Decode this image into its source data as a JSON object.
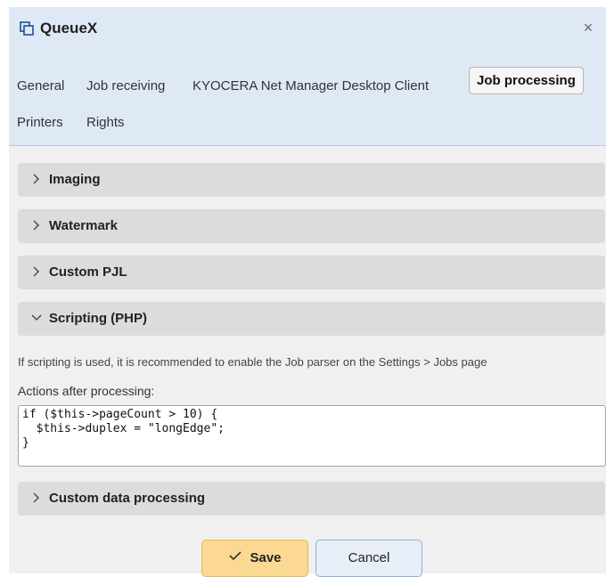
{
  "dialog": {
    "title": "QueueX",
    "close_label": "×",
    "tabs": [
      {
        "label": "General"
      },
      {
        "label": "Job receiving"
      },
      {
        "label": "KYOCERA Net Manager Desktop Client"
      },
      {
        "label": "Job processing",
        "active": true
      },
      {
        "label": "Printers"
      },
      {
        "label": "Rights"
      }
    ]
  },
  "sections": [
    {
      "label": "Imaging",
      "expanded": false
    },
    {
      "label": "Watermark",
      "expanded": false
    },
    {
      "label": "Custom PJL",
      "expanded": false
    },
    {
      "label": "Scripting (PHP)",
      "expanded": true
    },
    {
      "label": "Custom data processing",
      "expanded": false
    }
  ],
  "scripting": {
    "info": "If scripting is used, it is recommended to enable the Job parser on the Settings > Jobs page",
    "actions_label": "Actions after processing:",
    "code": "if ($this->pageCount > 10) {\n  $this->duplex = \"longEdge\";\n}"
  },
  "footer": {
    "save_label": "Save",
    "cancel_label": "Cancel"
  },
  "colors": {
    "header_bg": "#dfe9f6",
    "section_bg": "#dcdcdc",
    "save_bg": "#fbd992",
    "cancel_bg": "#e8eef7"
  },
  "icons": {
    "title": "copy-windows-icon",
    "collapsed": "chevron-right-icon",
    "expanded": "chevron-down-icon",
    "save": "check-icon"
  }
}
